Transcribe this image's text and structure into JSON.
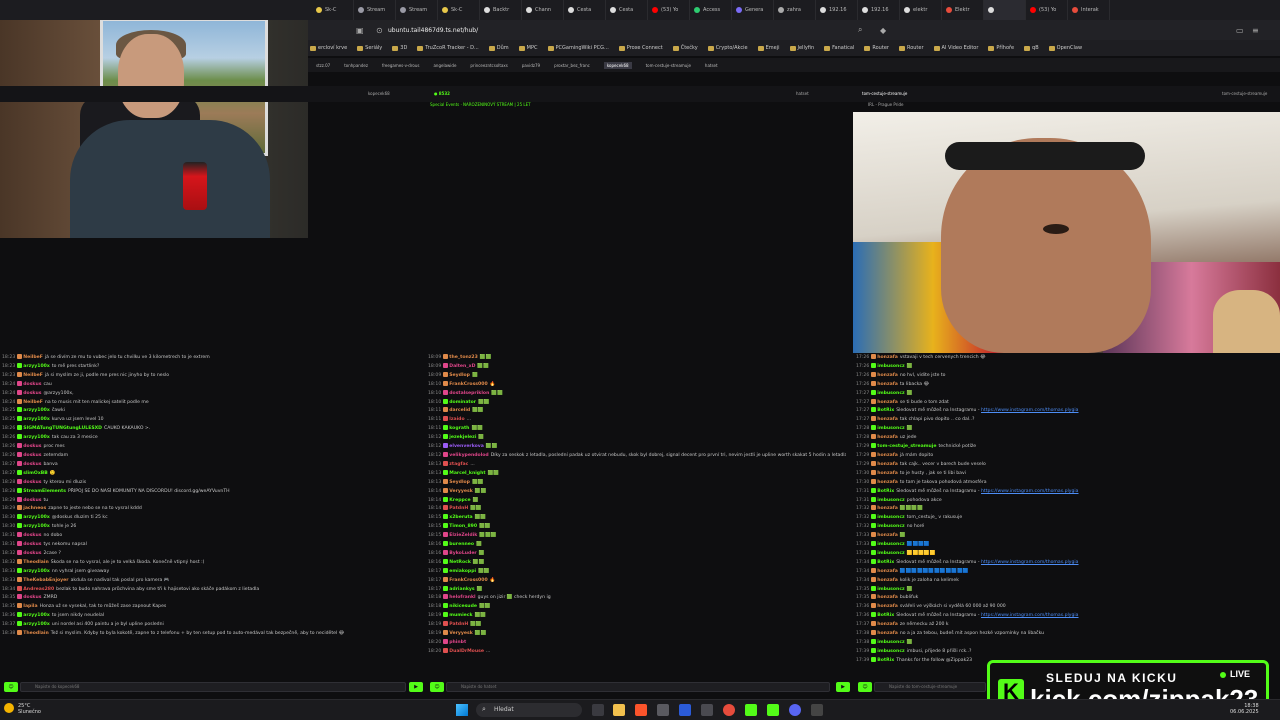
{
  "browser": {
    "tabs": [
      {
        "label": "Sk-C",
        "color": "#e8c84a"
      },
      {
        "label": "Stream",
        "color": "#9a9aa5"
      },
      {
        "label": "Stream",
        "color": "#9a9aa5"
      },
      {
        "label": "Sk-C",
        "color": "#e8c84a"
      },
      {
        "label": "Backtr",
        "color": "#ddd"
      },
      {
        "label": "Chann",
        "color": "#ddd"
      },
      {
        "label": "Cesta",
        "color": "#ddd"
      },
      {
        "label": "Cesta",
        "color": "#ddd"
      },
      {
        "label": "(53) Yo",
        "color": "#ff0000"
      },
      {
        "label": "Access",
        "color": "#2ecc71"
      },
      {
        "label": "Genera",
        "color": "#7b6cf6"
      },
      {
        "label": "zahra",
        "color": "#aaa"
      },
      {
        "label": "192.16",
        "color": "#ddd"
      },
      {
        "label": "192.16",
        "color": "#ddd"
      },
      {
        "label": "elektr",
        "color": "#ddd"
      },
      {
        "label": "Elektr",
        "color": "#e74c3c"
      },
      {
        "label": "",
        "color": "#ddd"
      },
      {
        "label": "(53) Yo",
        "color": "#ff0000"
      },
      {
        "label": "Interak",
        "color": "#e74c3c"
      }
    ],
    "url": "ubuntu.tail4867d9.ts.net/hub/",
    "bookmarks": [
      "ercloví krve",
      "Seriály",
      "3D",
      "TruZcoR Tracker - D...",
      "Dům",
      "MPC",
      "PCGamingWiki PCG...",
      "Proxe Connect",
      "Čtečky",
      "Crypto/Akcie",
      "Emeji",
      "Jellyfin",
      "Fanatical",
      "Router",
      "Router",
      "AI Video Editor",
      "Příhoře",
      "qB",
      "OpenClaw"
    ],
    "subtabs": [
      "stzz.07",
      "tonhpandez",
      "freegames-v-drous",
      "angelawide",
      "princeezntcsoltaxs",
      "pavidz79",
      "proxtar_bez_franc",
      "kopecek68",
      "tom-cestuje-streamuje",
      "hatset"
    ],
    "active_subtab": "kopecek68"
  },
  "channels": {
    "col1_name": "kopecek68",
    "col2_name": "hatset",
    "col3_name": "tom-cestuje-streamuje",
    "col2_live": "8532",
    "col3_title": "IRL - Prague Pride",
    "special_event": "Special Events · NAROZENINOVÝ STREAM | 25 LET"
  },
  "chat1": [
    {
      "ts": "18:23",
      "user": "NeilbeF",
      "color": "#e08a4a",
      "text": "já se divím ze mu to vubec jelo tu chvilku ve 3 kilometrech to je extrem"
    },
    {
      "ts": "18:23",
      "user": "arzyy100x",
      "color": "#53fc18",
      "text": "to mě pres startlink?"
    },
    {
      "ts": "18:23",
      "user": "NeilbeF",
      "color": "#e08a4a",
      "text": "já si myslím ze ji, podle me pres nic jinyho by to neslo"
    },
    {
      "ts": "18:24",
      "user": "doskus",
      "color": "#e0468a",
      "text": "cau"
    },
    {
      "ts": "18:24",
      "user": "doskus",
      "color": "#e0468a",
      "text": "@arzyy100x,"
    },
    {
      "ts": "18:24",
      "user": "NeilbeF",
      "color": "#e08a4a",
      "text": "na to musis mit ten malickej satelit podle me"
    },
    {
      "ts": "18:25",
      "user": "arzyy100x",
      "color": "#53fc18",
      "text": "čawki"
    },
    {
      "ts": "18:25",
      "user": "arzyy100x",
      "color": "#53fc18",
      "text": "kurva uz jsem level 10"
    },
    {
      "ts": "18:26",
      "user": "SIGMATungTUNGtungLULESXD",
      "color": "#53fc18",
      "text": "ČAUKO KAKAUKO >."
    },
    {
      "ts": "18:26",
      "user": "arzyy100x",
      "color": "#53fc18",
      "text": "tak cau za 3 mesice"
    },
    {
      "ts": "18:26",
      "user": "doskus",
      "color": "#e0468a",
      "text": "proc mes"
    },
    {
      "ts": "18:26",
      "user": "doskus",
      "color": "#e0468a",
      "text": "zetemdam"
    },
    {
      "ts": "18:27",
      "user": "doskus",
      "color": "#e0468a",
      "text": "banva"
    },
    {
      "ts": "18:27",
      "user": "slimOxBB",
      "color": "#53fc18",
      "text": "🙂"
    },
    {
      "ts": "18:28",
      "user": "doskus",
      "color": "#e0468a",
      "text": "ty kterou mi dluzis"
    },
    {
      "ts": "18:28",
      "user": "StreamElements",
      "color": "#53fc18",
      "text": "PŘIPOJ SE DO NAŠÍ KOMUNITY NA DISCORDU! discord.gg/weAYVuvnTH"
    },
    {
      "ts": "18:29",
      "user": "doskus",
      "color": "#e0468a",
      "text": "tu"
    },
    {
      "ts": "18:29",
      "user": "jachneos",
      "color": "#e08a4a",
      "text": "zapne to jeste nebo se na to vysral kddd"
    },
    {
      "ts": "18:30",
      "user": "arzyy100x",
      "color": "#53fc18",
      "text": "@doskus dluzim ti 25 kc"
    },
    {
      "ts": "18:30",
      "user": "arzyy100x",
      "color": "#53fc18",
      "text": "tohle je 26"
    },
    {
      "ts": "18:31",
      "user": "doskus",
      "color": "#e0468a",
      "text": "no dobo"
    },
    {
      "ts": "18:31",
      "user": "doskus",
      "color": "#e0468a",
      "text": "tys nekomu napsal"
    },
    {
      "ts": "18:32",
      "user": "doskus",
      "color": "#e0468a",
      "text": "2case ?"
    },
    {
      "ts": "18:32",
      "user": "Theodlain",
      "color": "#e08a4a",
      "text": "Škoda se na to vysral, ale je to velká škoda. Konečně vtipný host :("
    },
    {
      "ts": "18:33",
      "user": "arzyy100x",
      "color": "#53fc18",
      "text": "nn vyhral jsem giveaway"
    },
    {
      "ts": "18:33",
      "user": "TheKebabEnjoyer",
      "color": "#e08a4a",
      "text": "akdula se nadival tak poslal pro kamera 🎮"
    },
    {
      "ts": "18:34",
      "user": "Andreas280",
      "color": "#e05050",
      "text": "bezlak to budo nahrava průchvina aby sme tři k hajisetovi ako skáče padákom z lietadla"
    },
    {
      "ts": "18:35",
      "user": "doskus",
      "color": "#e0468a",
      "text": "ZMRD"
    },
    {
      "ts": "18:35",
      "user": "Iapila",
      "color": "#e08a4a",
      "text": "Honza už se vysekal, tak to můžeš zase zapnout Kapes"
    },
    {
      "ts": "18:36",
      "user": "arzyy100x",
      "color": "#53fc18",
      "text": "to jsem nikdy neudelal"
    },
    {
      "ts": "18:37",
      "user": "arzyy100x",
      "color": "#53fc18",
      "text": "uni nordel asi 400 paintu a je byl upline posledni"
    },
    {
      "ts": "18:38",
      "user": "Theodlain",
      "color": "#e08a4a",
      "text": "Tež si myslim. Kdyby to byla kokotě, zapne to z telefonu + by ten setup pod to auto-medával tak bezpečně, aby to necidětel 😂"
    }
  ],
  "chat2": [
    {
      "ts": "18:09",
      "user": "the_tonz23",
      "color": "#e08a4a",
      "text": "🟩🟩"
    },
    {
      "ts": "18:09",
      "user": "Dalten_xD",
      "color": "#e0468a",
      "text": "🟩🟩"
    },
    {
      "ts": "18:09",
      "user": "Seydlop",
      "color": "#e08a4a",
      "text": "🟩"
    },
    {
      "ts": "18:10",
      "user": "FrankCross000",
      "color": "#e08a4a",
      "text": "🔥"
    },
    {
      "ts": "18:10",
      "user": "dostalsepriklon",
      "color": "#e0468a",
      "text": "🟩🟩"
    },
    {
      "ts": "18:10",
      "user": "dominator",
      "color": "#53fc18",
      "text": "🟩🟩"
    },
    {
      "ts": "18:11",
      "user": "darcelid",
      "color": "#e08a4a",
      "text": "🟩🟩"
    },
    {
      "ts": "18:11",
      "user": "lzaido",
      "color": "#e05050",
      "text": "..."
    },
    {
      "ts": "18:11",
      "user": "kograth",
      "color": "#53fc18",
      "text": "🟩🟩"
    },
    {
      "ts": "18:12",
      "user": "jezekjelezi",
      "color": "#53fc18",
      "text": "🟩"
    },
    {
      "ts": "18:12",
      "user": "elvenverkova",
      "color": "#9b5cf6",
      "text": "🟩🟩"
    },
    {
      "ts": "18:12",
      "user": "velikypendolod",
      "color": "#e0468a",
      "text": "Díky za seskok z letadla, poslední padak uz otvirat nebudu, skok byl dobrej, signal decent pro první tri, nevim jestli je upline worth skakat 5 hodin a letadla pro 3 minuty streamu a jeste ten padak trochu"
    },
    {
      "ts": "18:13",
      "user": "ztagfac",
      "color": "#e05050",
      "text": "..."
    },
    {
      "ts": "18:13",
      "user": "Marcel_knight",
      "color": "#53fc18",
      "text": "🟩🟩"
    },
    {
      "ts": "18:13",
      "user": "Seydlop",
      "color": "#e08a4a",
      "text": "🟩🟩"
    },
    {
      "ts": "18:14",
      "user": "Veryyesk",
      "color": "#e08a4a",
      "text": "🟩🟩"
    },
    {
      "ts": "18:14",
      "user": "Kreppce",
      "color": "#53fc18",
      "text": "🟩"
    },
    {
      "ts": "18:14",
      "user": "PatdnH",
      "color": "#e05050",
      "text": "🟩🟩"
    },
    {
      "ts": "18:15",
      "user": "x2beruta",
      "color": "#53fc18",
      "text": "🟩🟩"
    },
    {
      "ts": "18:15",
      "user": "Timon_890",
      "color": "#53fc18",
      "text": "🟩🟩"
    },
    {
      "ts": "18:15",
      "user": "ElzieZeldik",
      "color": "#e0468a",
      "text": "🟩🟩🟩"
    },
    {
      "ts": "18:16",
      "user": "burenneo",
      "color": "#53fc18",
      "text": "🟩"
    },
    {
      "ts": "18:16",
      "user": "BykoLuder",
      "color": "#e0468a",
      "text": "🟩"
    },
    {
      "ts": "18:16",
      "user": "NetRock",
      "color": "#53fc18",
      "text": "🟩🟩"
    },
    {
      "ts": "18:17",
      "user": "emiakoppi",
      "color": "#53fc18",
      "text": "🟩🟩"
    },
    {
      "ts": "18:17",
      "user": "FrankCross000",
      "color": "#e08a4a",
      "text": "🔥"
    },
    {
      "ts": "18:17",
      "user": "adriankys",
      "color": "#53fc18",
      "text": "🟩"
    },
    {
      "ts": "18:18",
      "user": "helofrankl",
      "color": "#e0468a",
      "text": "guys on jizir 🟩 check herdyn ig"
    },
    {
      "ts": "18:18",
      "user": "nikicesude",
      "color": "#53fc18",
      "text": "🟩🟩"
    },
    {
      "ts": "18:19",
      "user": "mumieck",
      "color": "#53fc18",
      "text": "🟩🟩"
    },
    {
      "ts": "18:19",
      "user": "PatdnH",
      "color": "#e05050",
      "text": "🟩🟩"
    },
    {
      "ts": "18:19",
      "user": "Veryyesk",
      "color": "#e08a4a",
      "text": "🟩🟩"
    },
    {
      "ts": "18:20",
      "user": "phinbt",
      "color": "#e0468a",
      "text": ""
    },
    {
      "ts": "18:20",
      "user": "DualDrMouse",
      "color": "#e05050",
      "text": "..."
    }
  ],
  "chat3": [
    {
      "ts": "17:26",
      "user": "honzafa",
      "color": "#e08a4a",
      "text": "vstavaji v tech cervenych trencich 😂"
    },
    {
      "ts": "17:26",
      "user": "imbusoncz",
      "color": "#53fc18",
      "text": "🟩"
    },
    {
      "ts": "17:26",
      "user": "honzafa",
      "color": "#e08a4a",
      "text": "no hvl, vidite jste to"
    },
    {
      "ts": "17:26",
      "user": "honzafa",
      "color": "#e08a4a",
      "text": "ta libacka 😂"
    },
    {
      "ts": "17:27",
      "user": "imbusoncz",
      "color": "#53fc18",
      "text": "🟩"
    },
    {
      "ts": "17:27",
      "user": "honzafa",
      "color": "#e08a4a",
      "text": "se ti bude o tom zdat"
    },
    {
      "ts": "17:27",
      "user": "BotRix",
      "color": "#53fc18",
      "text": "Sledovat mě můžeš na Instagramu - ",
      "link": "https://www.instagram.com/thomas.plygia"
    },
    {
      "ts": "17:27",
      "user": "honzafa",
      "color": "#e08a4a",
      "text": "tak chlapi pivo dopito .. co dal..?"
    },
    {
      "ts": "17:28",
      "user": "imbusoncz",
      "color": "#53fc18",
      "text": "🟩"
    },
    {
      "ts": "17:28",
      "user": "honzafa",
      "color": "#e08a4a",
      "text": "uz jede"
    },
    {
      "ts": "17:29",
      "user": "tom-cestuje_streamuje",
      "color": "#53fc18",
      "text": "technické potíže"
    },
    {
      "ts": "17:29",
      "user": "honzafa",
      "color": "#e08a4a",
      "text": "já mám dopito"
    },
    {
      "ts": "17:29",
      "user": "honzafa",
      "color": "#e08a4a",
      "text": "tak cajk.. vecer v barech bude veselo"
    },
    {
      "ts": "17:30",
      "user": "honzafa",
      "color": "#e08a4a",
      "text": "to je husty , jak se ti libi bavi"
    },
    {
      "ts": "17:30",
      "user": "honzafa",
      "color": "#e08a4a",
      "text": "to tam je takova pohodová atmosféra"
    },
    {
      "ts": "17:31",
      "user": "BotRix",
      "color": "#53fc18",
      "text": "Sledovat mě můžeš na Instagramu - ",
      "link": "https://www.instagram.com/thomas.plygia"
    },
    {
      "ts": "17:31",
      "user": "imbusoncz",
      "color": "#53fc18",
      "text": "pohodova akce"
    },
    {
      "ts": "17:32",
      "user": "honzafa",
      "color": "#e08a4a",
      "text": "🟩🟩🟩🟩"
    },
    {
      "ts": "17:32",
      "user": "imbusoncz",
      "color": "#53fc18",
      "text": "tom_cestuje_ v rakusuje"
    },
    {
      "ts": "17:32",
      "user": "imbusoncz",
      "color": "#53fc18",
      "text": "no horé"
    },
    {
      "ts": "17:33",
      "user": "honzafa",
      "color": "#e08a4a",
      "text": "🟩"
    },
    {
      "ts": "17:33",
      "user": "imbusoncz",
      "color": "#53fc18",
      "text": "🟦🟦🟦🟦"
    },
    {
      "ts": "17:33",
      "user": "imbusoncz",
      "color": "#53fc18",
      "text": "🟨🟨🟨🟨🟨"
    },
    {
      "ts": "17:34",
      "user": "BotRix",
      "color": "#53fc18",
      "text": "Sledovat mě můžeš na Instagramu - ",
      "link": "https://www.instagram.com/thomas.plygia"
    },
    {
      "ts": "17:34",
      "user": "honzafa",
      "color": "#e08a4a",
      "text": "🟦🟦🟦🟦🟦🟦🟦🟦🟦🟦🟦🟦"
    },
    {
      "ts": "17:34",
      "user": "honzafa",
      "color": "#e08a4a",
      "text": "kolik je zaloha na kelimek"
    },
    {
      "ts": "17:35",
      "user": "imbusoncz",
      "color": "#53fc18",
      "text": "🟩"
    },
    {
      "ts": "17:35",
      "user": "honzafa",
      "color": "#e08a4a",
      "text": "bublifuk"
    },
    {
      "ts": "17:36",
      "user": "honzafa",
      "color": "#e08a4a",
      "text": "svářeli ve výškách si vydělá 60 000 až 90 000"
    },
    {
      "ts": "17:36",
      "user": "BotRix",
      "color": "#53fc18",
      "text": "Sledovat mě můžeš na Instagramu - ",
      "link": "https://www.instagram.com/thomas.plygia"
    },
    {
      "ts": "17:37",
      "user": "honzafa",
      "color": "#e08a4a",
      "text": "ze německu až 200 k"
    },
    {
      "ts": "17:38",
      "user": "honzafa",
      "color": "#e08a4a",
      "text": "no a ja za tebou, budeš mit aspon hezké vzpomínky na libačku"
    },
    {
      "ts": "17:38",
      "user": "imbusoncz",
      "color": "#53fc18",
      "text": "🟩"
    },
    {
      "ts": "17:39",
      "user": "imbusoncz",
      "color": "#53fc18",
      "text": "imbusi, přijede 8 přišli rck..?"
    },
    {
      "ts": "17:39",
      "user": "BotRix",
      "color": "#53fc18",
      "text": "Thanks for the follow @Zippak23"
    }
  ],
  "inputs": {
    "placeholder1": "Napiste do kopecek68",
    "placeholder2": "Napiste do hatset",
    "placeholder3": "Napiste do tom-cestuje-streamuje"
  },
  "kick_overlay": {
    "top_text": "SLEDUJ NA KICKU",
    "url_text": "kick.com/zippak23",
    "live_text": "LIVE",
    "logo": "K",
    "accent": "#53fc18"
  },
  "taskbar": {
    "weather_temp": "25°C",
    "weather_desc": "Slunečno",
    "search": "Hledat",
    "time": "18:38",
    "date": "06.06.2025"
  }
}
